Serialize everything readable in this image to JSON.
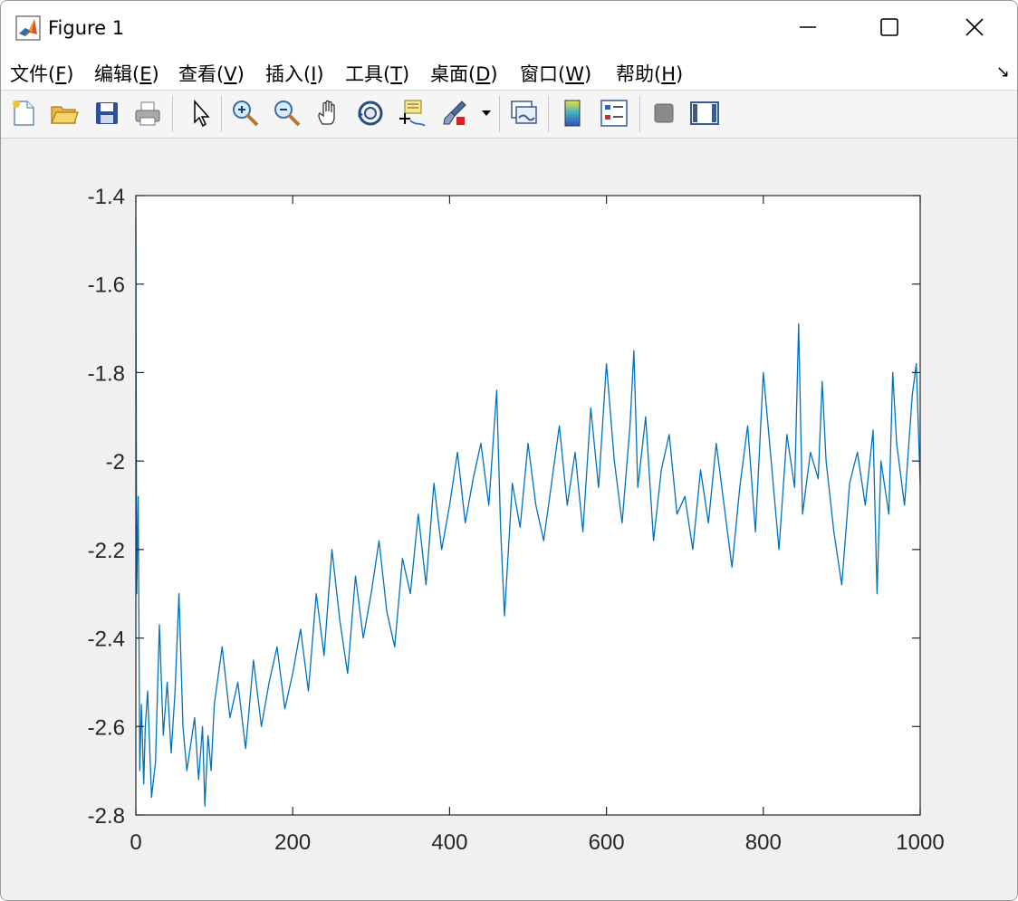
{
  "window": {
    "title": "Figure 1",
    "accent": "#0072bd",
    "controls": [
      "minimize",
      "maximize",
      "close"
    ]
  },
  "menubar": {
    "items": [
      {
        "name": "文件",
        "key": "F"
      },
      {
        "name": "编辑",
        "key": "E"
      },
      {
        "name": "查看",
        "key": "V"
      },
      {
        "name": "插入",
        "key": "I"
      },
      {
        "name": "工具",
        "key": "T"
      },
      {
        "name": "桌面",
        "key": "D"
      },
      {
        "name": "窗口",
        "key": "W"
      },
      {
        "name": "帮助",
        "key": "H"
      }
    ]
  },
  "toolbar": {
    "icons": [
      "new-figure-icon",
      "open-file-icon",
      "save-icon",
      "print-icon",
      "edit-plot-arrow-icon",
      "zoom-in-icon",
      "zoom-out-icon",
      "pan-hand-icon",
      "rotate-3d-icon",
      "data-cursor-icon",
      "brush-icon",
      "brush-dropdown-icon",
      "link-plot-icon",
      "colorbar-icon",
      "legend-icon",
      "hide-plot-tools-icon",
      "show-plot-tools-icon"
    ]
  },
  "chart_data": {
    "type": "line",
    "xlim": [
      0,
      1000
    ],
    "ylim": [
      -2.8,
      -1.4
    ],
    "xticks": [
      0,
      200,
      400,
      600,
      800,
      1000
    ],
    "yticks": [
      -2.8,
      -2.6,
      -2.4,
      -2.2,
      -2,
      -1.8,
      -1.6,
      -1.4
    ],
    "xtick_labels": [
      "0",
      "200",
      "400",
      "600",
      "800",
      "1000"
    ],
    "ytick_labels": [
      "-2.8",
      "-2.6",
      "-2.4",
      "-2.2",
      "-2",
      "-1.8",
      "-1.6",
      "-1.4"
    ],
    "grid": false,
    "series": [
      {
        "color": "#0072bd",
        "x": [
          0,
          1,
          3,
          5,
          7,
          10,
          12,
          15,
          20,
          25,
          30,
          35,
          40,
          45,
          50,
          55,
          60,
          65,
          70,
          75,
          80,
          85,
          88,
          92,
          96,
          100,
          110,
          120,
          130,
          140,
          150,
          160,
          170,
          180,
          190,
          200,
          210,
          220,
          230,
          240,
          250,
          260,
          270,
          280,
          290,
          300,
          310,
          320,
          330,
          340,
          350,
          360,
          370,
          380,
          390,
          400,
          410,
          420,
          430,
          440,
          450,
          460,
          465,
          470,
          480,
          490,
          500,
          510,
          520,
          530,
          540,
          550,
          560,
          570,
          580,
          590,
          600,
          610,
          620,
          630,
          635,
          640,
          650,
          660,
          670,
          680,
          690,
          700,
          710,
          720,
          730,
          740,
          750,
          760,
          770,
          780,
          790,
          800,
          810,
          820,
          830,
          840,
          845,
          850,
          860,
          870,
          875,
          880,
          890,
          900,
          910,
          920,
          930,
          940,
          945,
          950,
          960,
          965,
          970,
          980,
          990,
          995,
          1000
        ],
        "y": [
          -1.45,
          -2.3,
          -2.08,
          -2.7,
          -2.55,
          -2.73,
          -2.6,
          -2.52,
          -2.76,
          -2.68,
          -2.37,
          -2.62,
          -2.5,
          -2.66,
          -2.52,
          -2.3,
          -2.6,
          -2.7,
          -2.64,
          -2.58,
          -2.72,
          -2.6,
          -2.78,
          -2.62,
          -2.7,
          -2.55,
          -2.42,
          -2.58,
          -2.5,
          -2.65,
          -2.45,
          -2.6,
          -2.5,
          -2.42,
          -2.56,
          -2.48,
          -2.38,
          -2.52,
          -2.3,
          -2.44,
          -2.2,
          -2.36,
          -2.48,
          -2.26,
          -2.4,
          -2.3,
          -2.18,
          -2.34,
          -2.42,
          -2.22,
          -2.3,
          -2.12,
          -2.28,
          -2.05,
          -2.2,
          -2.1,
          -1.98,
          -2.14,
          -2.04,
          -1.96,
          -2.1,
          -1.84,
          -2.15,
          -2.35,
          -2.05,
          -2.15,
          -1.96,
          -2.1,
          -2.18,
          -2.05,
          -1.92,
          -2.1,
          -1.98,
          -2.16,
          -1.88,
          -2.06,
          -1.78,
          -2.0,
          -2.14,
          -1.92,
          -1.75,
          -2.06,
          -1.9,
          -2.18,
          -2.02,
          -1.94,
          -2.12,
          -2.08,
          -2.2,
          -2.02,
          -2.14,
          -1.96,
          -2.1,
          -2.24,
          -2.06,
          -1.92,
          -2.16,
          -1.8,
          -2.0,
          -2.2,
          -1.94,
          -2.06,
          -1.69,
          -2.12,
          -1.98,
          -2.04,
          -1.82,
          -2.0,
          -2.16,
          -2.28,
          -2.05,
          -1.98,
          -2.1,
          -1.93,
          -2.3,
          -2.0,
          -2.12,
          -1.8,
          -1.96,
          -2.1,
          -1.85,
          -1.78,
          -2.05
        ]
      }
    ]
  }
}
